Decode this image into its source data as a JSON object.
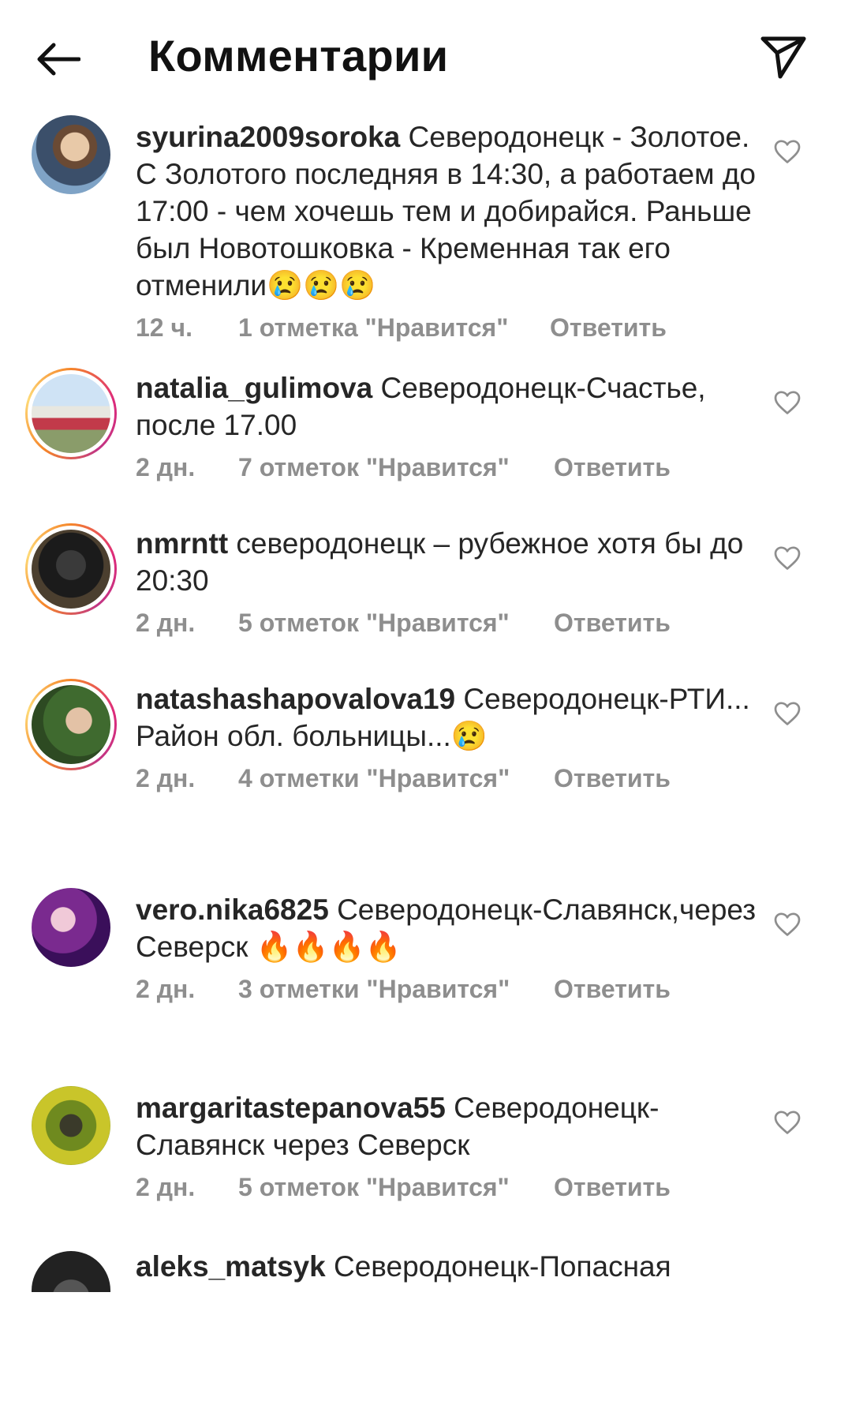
{
  "header": {
    "title": "Комментарии"
  },
  "comments": [
    {
      "username": "syurina2009soroka",
      "text": " Северодонецк - Золотое. С Золотого последняя в 14:30, а работаем до 17:00 - чем хочешь тем и добирайся. Раньше был Новотошковка - Кременная так его отменили😢😢😢",
      "time": "12 ч.",
      "likes": "1 отметка \"Нравится\"",
      "reply": "Ответить"
    },
    {
      "username": "natalia_gulimova",
      "text": " Северодонецк-Счастье, после 17.00",
      "time": "2 дн.",
      "likes": "7 отметок \"Нравится\"",
      "reply": "Ответить"
    },
    {
      "username": "nmrntt",
      "text": " северодонецк – рубежное хотя бы до 20:30",
      "time": "2 дн.",
      "likes": "5 отметок \"Нравится\"",
      "reply": "Ответить"
    },
    {
      "username": "natashashapovalova19",
      "text": " Северодонецк-РТИ... Район обл. больницы...😢",
      "time": "2 дн.",
      "likes": "4 отметки \"Нравится\"",
      "reply": "Ответить"
    },
    {
      "username": "vero.nika6825",
      "text": " Северодонецк-Славянск,через Северск 🔥🔥🔥🔥",
      "time": "2 дн.",
      "likes": "3 отметки \"Нравится\"",
      "reply": "Ответить"
    },
    {
      "username": "margaritastepanova55",
      "text": " Северодонецк-Славянск  через Северск",
      "time": "2 дн.",
      "likes": "5 отметок \"Нравится\"",
      "reply": "Ответить"
    },
    {
      "username": "aleks_matsyk",
      "text": " Северодонецк-Попасная"
    }
  ],
  "icons": {
    "back": "arrow-left-icon",
    "share": "paper-plane-icon",
    "like": "heart-outline-icon"
  }
}
